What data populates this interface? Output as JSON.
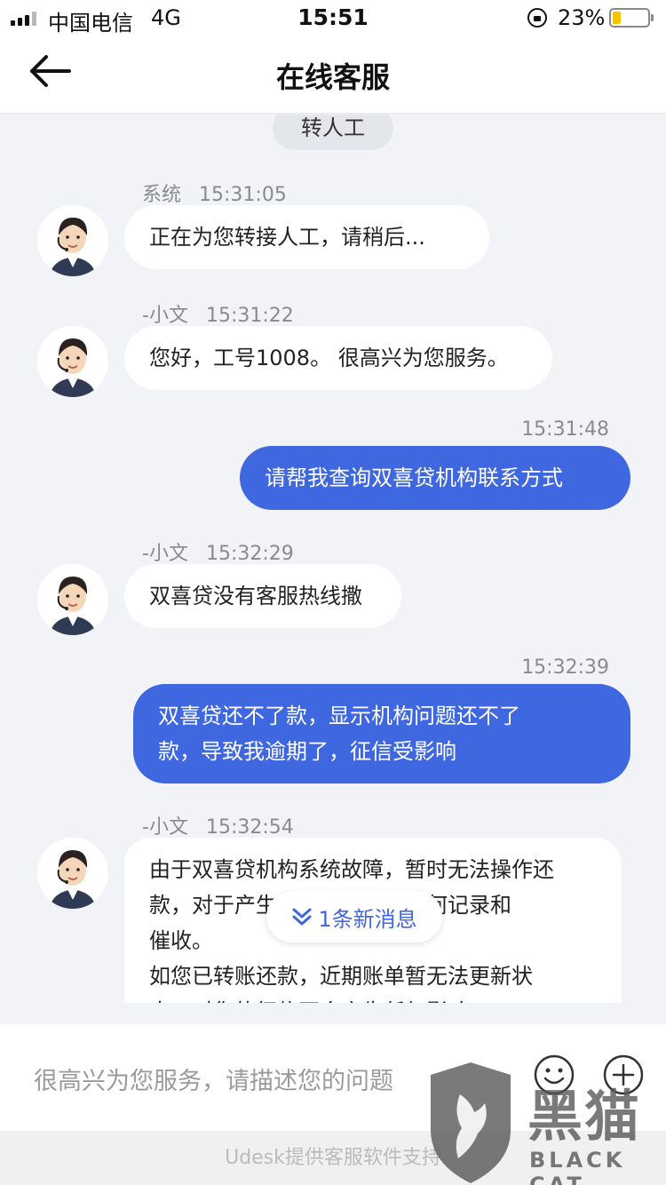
{
  "status_bar": {
    "carrier": "中国电信",
    "network": "4G",
    "time": "15:51",
    "battery": "23%",
    "battery_level": 0.23
  },
  "nav": {
    "title": "在线客服"
  },
  "chat": {
    "transfer_label": "转人工",
    "messages": [
      {
        "side": "in",
        "sender": "系统",
        "time": "15:31:05",
        "lines": [
          "正在为您转接人工，请稍后..."
        ]
      },
      {
        "side": "in",
        "sender": "-小文",
        "time": "15:31:22",
        "lines": [
          "您好，工号1008。 很高兴为您服务。"
        ]
      },
      {
        "side": "out",
        "time": "15:31:48",
        "lines": [
          "请帮我查询双喜贷机构联系方式"
        ]
      },
      {
        "side": "in",
        "sender": "-小文",
        "time": "15:32:29",
        "lines": [
          "双喜贷没有客服热线撒"
        ]
      },
      {
        "side": "out",
        "time": "15:32:39",
        "lines": [
          "双喜贷还不了款，显示机构问题还不了",
          "款，导致我逾期了，征信受影响"
        ]
      },
      {
        "side": "in",
        "sender": "-小文",
        "time": "15:32:54",
        "lines": [
          "由于双喜贷机构系统故障，暂时无法操作还",
          "款，对于产生的逾期，不做任何记录和",
          "催收。",
          "如您已转账还款，近期账单暂无法更新状",
          "态，对您的征信不会产生任何影响"
        ]
      }
    ],
    "new_message_label": "1条新消息"
  },
  "input": {
    "placeholder": "很高兴为您服务，请描述您的问题"
  },
  "footer": {
    "text": "Udesk提供客服软件支持"
  },
  "watermark": {
    "title": "黑猫",
    "subtitle": "BLACK CAT"
  },
  "colors": {
    "accent": "#3f68e0",
    "background": "#f1f3f7"
  }
}
